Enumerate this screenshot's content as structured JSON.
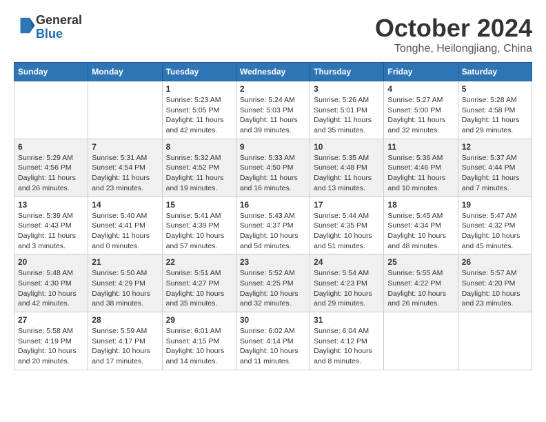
{
  "header": {
    "logo_line1": "General",
    "logo_line2": "Blue",
    "month_title": "October 2024",
    "location": "Tonghe, Heilongjiang, China"
  },
  "days_of_week": [
    "Sunday",
    "Monday",
    "Tuesday",
    "Wednesday",
    "Thursday",
    "Friday",
    "Saturday"
  ],
  "weeks": [
    [
      {
        "day": null,
        "info": null
      },
      {
        "day": null,
        "info": null
      },
      {
        "day": "1",
        "info": "Sunrise: 5:23 AM\nSunset: 5:05 PM\nDaylight: 11 hours and 42 minutes."
      },
      {
        "day": "2",
        "info": "Sunrise: 5:24 AM\nSunset: 5:03 PM\nDaylight: 11 hours and 39 minutes."
      },
      {
        "day": "3",
        "info": "Sunrise: 5:26 AM\nSunset: 5:01 PM\nDaylight: 11 hours and 35 minutes."
      },
      {
        "day": "4",
        "info": "Sunrise: 5:27 AM\nSunset: 5:00 PM\nDaylight: 11 hours and 32 minutes."
      },
      {
        "day": "5",
        "info": "Sunrise: 5:28 AM\nSunset: 4:58 PM\nDaylight: 11 hours and 29 minutes."
      }
    ],
    [
      {
        "day": "6",
        "info": "Sunrise: 5:29 AM\nSunset: 4:56 PM\nDaylight: 11 hours and 26 minutes."
      },
      {
        "day": "7",
        "info": "Sunrise: 5:31 AM\nSunset: 4:54 PM\nDaylight: 11 hours and 23 minutes."
      },
      {
        "day": "8",
        "info": "Sunrise: 5:32 AM\nSunset: 4:52 PM\nDaylight: 11 hours and 19 minutes."
      },
      {
        "day": "9",
        "info": "Sunrise: 5:33 AM\nSunset: 4:50 PM\nDaylight: 11 hours and 16 minutes."
      },
      {
        "day": "10",
        "info": "Sunrise: 5:35 AM\nSunset: 4:48 PM\nDaylight: 11 hours and 13 minutes."
      },
      {
        "day": "11",
        "info": "Sunrise: 5:36 AM\nSunset: 4:46 PM\nDaylight: 11 hours and 10 minutes."
      },
      {
        "day": "12",
        "info": "Sunrise: 5:37 AM\nSunset: 4:44 PM\nDaylight: 11 hours and 7 minutes."
      }
    ],
    [
      {
        "day": "13",
        "info": "Sunrise: 5:39 AM\nSunset: 4:43 PM\nDaylight: 11 hours and 3 minutes."
      },
      {
        "day": "14",
        "info": "Sunrise: 5:40 AM\nSunset: 4:41 PM\nDaylight: 11 hours and 0 minutes."
      },
      {
        "day": "15",
        "info": "Sunrise: 5:41 AM\nSunset: 4:39 PM\nDaylight: 10 hours and 57 minutes."
      },
      {
        "day": "16",
        "info": "Sunrise: 5:43 AM\nSunset: 4:37 PM\nDaylight: 10 hours and 54 minutes."
      },
      {
        "day": "17",
        "info": "Sunrise: 5:44 AM\nSunset: 4:35 PM\nDaylight: 10 hours and 51 minutes."
      },
      {
        "day": "18",
        "info": "Sunrise: 5:45 AM\nSunset: 4:34 PM\nDaylight: 10 hours and 48 minutes."
      },
      {
        "day": "19",
        "info": "Sunrise: 5:47 AM\nSunset: 4:32 PM\nDaylight: 10 hours and 45 minutes."
      }
    ],
    [
      {
        "day": "20",
        "info": "Sunrise: 5:48 AM\nSunset: 4:30 PM\nDaylight: 10 hours and 42 minutes."
      },
      {
        "day": "21",
        "info": "Sunrise: 5:50 AM\nSunset: 4:29 PM\nDaylight: 10 hours and 38 minutes."
      },
      {
        "day": "22",
        "info": "Sunrise: 5:51 AM\nSunset: 4:27 PM\nDaylight: 10 hours and 35 minutes."
      },
      {
        "day": "23",
        "info": "Sunrise: 5:52 AM\nSunset: 4:25 PM\nDaylight: 10 hours and 32 minutes."
      },
      {
        "day": "24",
        "info": "Sunrise: 5:54 AM\nSunset: 4:23 PM\nDaylight: 10 hours and 29 minutes."
      },
      {
        "day": "25",
        "info": "Sunrise: 5:55 AM\nSunset: 4:22 PM\nDaylight: 10 hours and 26 minutes."
      },
      {
        "day": "26",
        "info": "Sunrise: 5:57 AM\nSunset: 4:20 PM\nDaylight: 10 hours and 23 minutes."
      }
    ],
    [
      {
        "day": "27",
        "info": "Sunrise: 5:58 AM\nSunset: 4:19 PM\nDaylight: 10 hours and 20 minutes."
      },
      {
        "day": "28",
        "info": "Sunrise: 5:59 AM\nSunset: 4:17 PM\nDaylight: 10 hours and 17 minutes."
      },
      {
        "day": "29",
        "info": "Sunrise: 6:01 AM\nSunset: 4:15 PM\nDaylight: 10 hours and 14 minutes."
      },
      {
        "day": "30",
        "info": "Sunrise: 6:02 AM\nSunset: 4:14 PM\nDaylight: 10 hours and 11 minutes."
      },
      {
        "day": "31",
        "info": "Sunrise: 6:04 AM\nSunset: 4:12 PM\nDaylight: 10 hours and 8 minutes."
      },
      {
        "day": null,
        "info": null
      },
      {
        "day": null,
        "info": null
      }
    ]
  ]
}
